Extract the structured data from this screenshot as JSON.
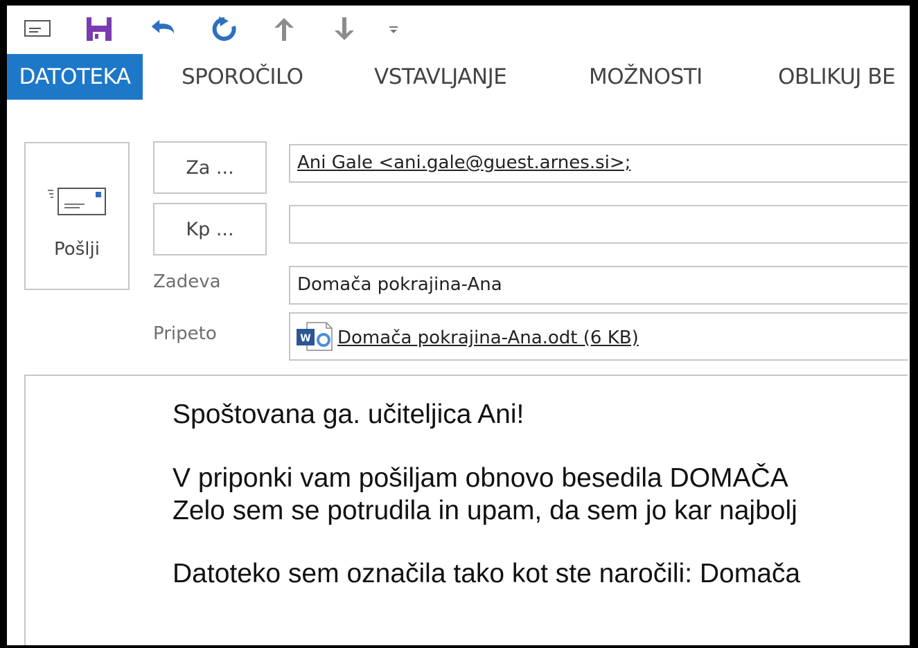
{
  "quick_access": {
    "icons": [
      "envelope-icon",
      "save-icon",
      "undo-icon",
      "redo-icon",
      "arrow-up-icon",
      "arrow-down-icon",
      "customize-icon"
    ],
    "colors": {
      "save": "#7a3cb0",
      "undo": "#2d6fc0",
      "muted": "#8c8c8c"
    }
  },
  "tabs": [
    {
      "label": "DATOTEKA",
      "active": true
    },
    {
      "label": "SPOROČILO"
    },
    {
      "label": "VSTAVLJANJE"
    },
    {
      "label": "MOŽNOSTI"
    },
    {
      "label": "OBLIKUJ BE"
    }
  ],
  "accent": "#1e78c8",
  "send": {
    "label": "Pošlji"
  },
  "to": {
    "button": "Za ...",
    "value": "Ani Gale <ani.gale@guest.arnes.si>;"
  },
  "cc": {
    "button": "Kp ...",
    "value": ""
  },
  "subject": {
    "label": "Zadeva",
    "value": "Domača pokrajina-Ana"
  },
  "attachment": {
    "label": "Pripeto",
    "file": "Domača pokrajina-Ana.odt (6 KB)"
  },
  "body": {
    "lines": [
      "Spoštovana ga. učiteljica Ani!",
      "V priponki vam pošiljam obnovo besedila DOMAČA",
      "Zelo sem se potrudila in upam, da sem jo kar najbolj",
      "Datoteko sem označila tako kot ste naročili: Domača"
    ]
  }
}
